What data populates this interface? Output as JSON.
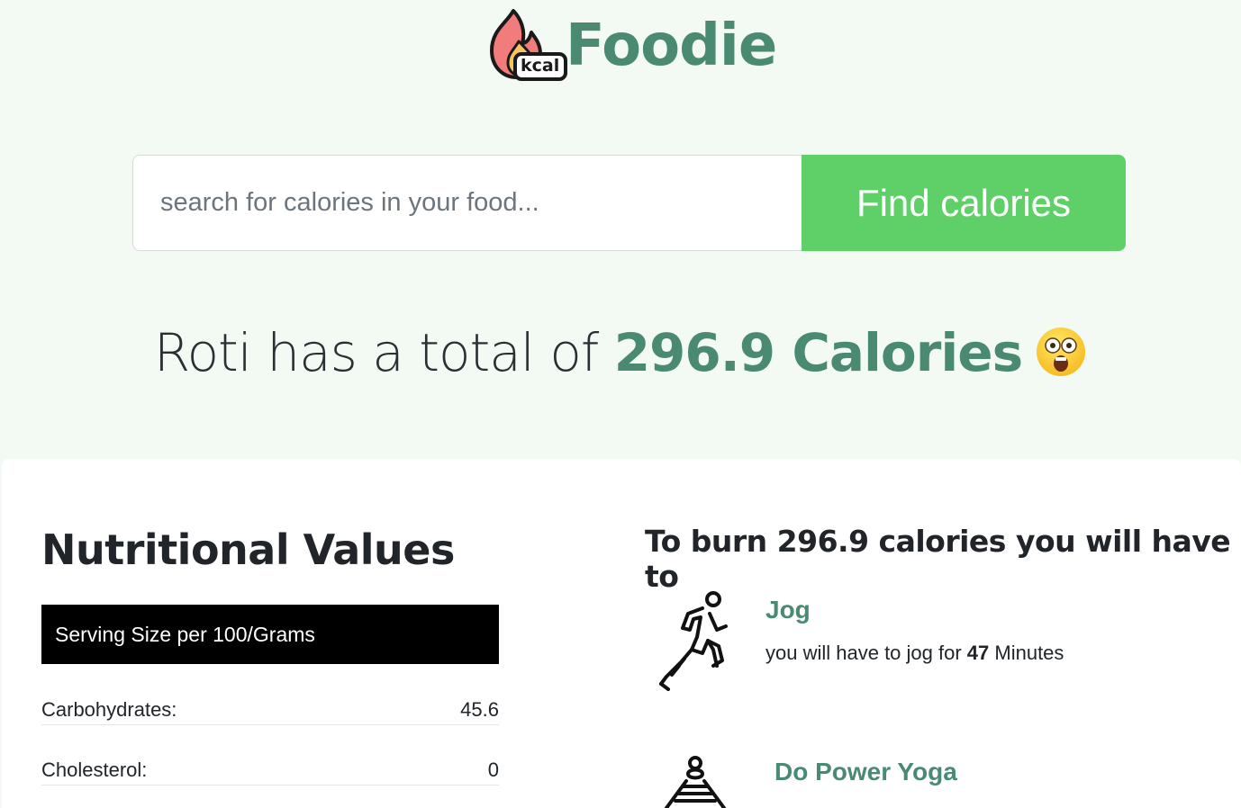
{
  "header": {
    "brand": "Foodie",
    "logo_badge": "kcal",
    "logo_icon": "flame-icon"
  },
  "search": {
    "placeholder": "search for calories in your food...",
    "button_label": "Find calories"
  },
  "result": {
    "prefix": "Roti has a total of ",
    "calories": "296.9 Calories",
    "emoji_icon": "shocked-face-icon"
  },
  "nutrition": {
    "title": "Nutritional Values",
    "serving": "Serving Size per 100/Grams",
    "rows": [
      {
        "label": "Carbohydrates:",
        "value": "45.6"
      },
      {
        "label": "Cholesterol:",
        "value": "0"
      }
    ]
  },
  "burn": {
    "title": "To burn 296.9 calories you will have to",
    "activities": [
      {
        "name": "Jog",
        "desc_prefix": "you will have to jog for ",
        "amount": "47",
        "desc_suffix": " Minutes",
        "icon": "runner-icon"
      },
      {
        "name": "Do Power Yoga",
        "icon": "yoga-icon"
      }
    ]
  },
  "colors": {
    "page_bg": "#f3f9f3",
    "accent": "#4a8a72",
    "button": "#5fd068"
  }
}
